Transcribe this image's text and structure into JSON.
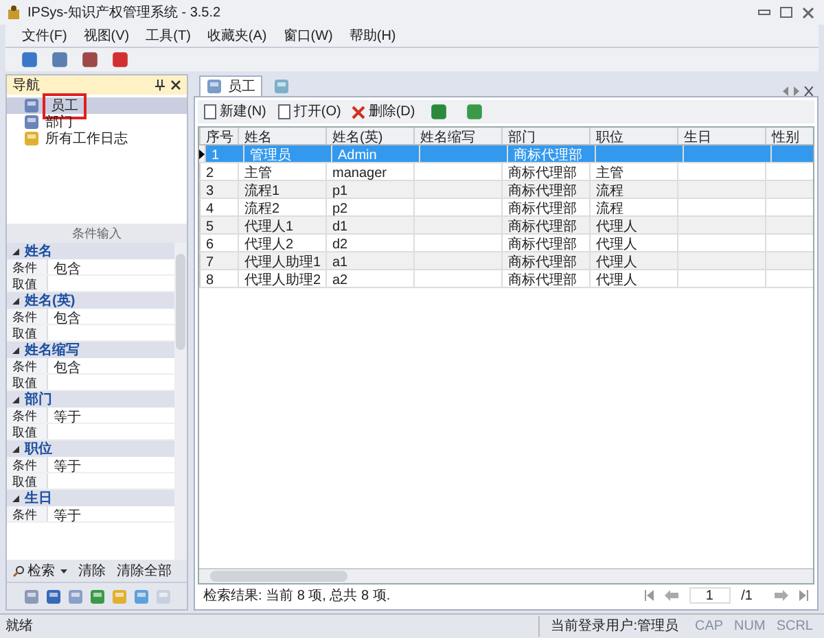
{
  "window": {
    "title": "IPSys-知识产权管理系统 - 3.5.2"
  },
  "menu": [
    "文件(F)",
    "视图(V)",
    "工具(T)",
    "收藏夹(A)",
    "窗口(W)",
    "帮助(H)"
  ],
  "nav": {
    "title": "导航",
    "items": [
      {
        "label": "员工",
        "selected": true
      },
      {
        "label": "部门",
        "selected": false
      },
      {
        "label": "所有工作日志",
        "selected": false
      }
    ]
  },
  "conditions": {
    "title": "条件输入",
    "groups": [
      {
        "name": "姓名",
        "rows": [
          {
            "label": "条件",
            "value": "包含"
          },
          {
            "label": "取值"
          }
        ]
      },
      {
        "name": "姓名(英)",
        "rows": [
          {
            "label": "条件",
            "value": "包含"
          },
          {
            "label": "取值"
          }
        ]
      },
      {
        "name": "姓名缩写",
        "rows": [
          {
            "label": "条件",
            "value": "包含"
          },
          {
            "label": "取值"
          }
        ]
      },
      {
        "name": "部门",
        "rows": [
          {
            "label": "条件",
            "value": "等于"
          },
          {
            "label": "取值"
          }
        ]
      },
      {
        "name": "职位",
        "rows": [
          {
            "label": "条件",
            "value": "等于"
          },
          {
            "label": "取值"
          }
        ]
      },
      {
        "name": "生日",
        "rows": [
          {
            "label": "条件",
            "value": "等于"
          }
        ]
      }
    ],
    "actions": [
      "检索",
      "清除",
      "清除全部"
    ]
  },
  "tabs": [
    {
      "label": "员工",
      "selected": true
    }
  ],
  "toolbar": [
    "新建(N)",
    "打开(O)",
    "删除(D)"
  ],
  "table": {
    "columns": [
      "序号",
      "姓名",
      "姓名(英)",
      "姓名缩写",
      "部门",
      "职位",
      "生日",
      "性别"
    ],
    "rows": [
      {
        "cells": [
          "1",
          "管理员",
          "Admin",
          "",
          "商标代理部",
          "",
          "",
          ""
        ],
        "selected": true
      },
      {
        "cells": [
          "2",
          "主管",
          "manager",
          "",
          "商标代理部",
          "主管",
          "",
          ""
        ],
        "selected": false
      },
      {
        "cells": [
          "3",
          "流程1",
          "p1",
          "",
          "商标代理部",
          "流程",
          "",
          ""
        ],
        "selected": false
      },
      {
        "cells": [
          "4",
          "流程2",
          "p2",
          "",
          "商标代理部",
          "流程",
          "",
          ""
        ],
        "selected": false
      },
      {
        "cells": [
          "5",
          "代理人1",
          "d1",
          "",
          "商标代理部",
          "代理人",
          "",
          ""
        ],
        "selected": false
      },
      {
        "cells": [
          "6",
          "代理人2",
          "d2",
          "",
          "商标代理部",
          "代理人",
          "",
          ""
        ],
        "selected": false
      },
      {
        "cells": [
          "7",
          "代理人助理1",
          "a1",
          "",
          "商标代理部",
          "代理人",
          "",
          ""
        ],
        "selected": false
      },
      {
        "cells": [
          "8",
          "代理人助理2",
          "a2",
          "",
          "商标代理部",
          "代理人",
          "",
          ""
        ],
        "selected": false
      }
    ]
  },
  "result": "检索结果: 当前 8 项, 总共 8 项.",
  "pager": {
    "page": "1",
    "total": "/1"
  },
  "status_bar": {
    "text": "就绪",
    "user": "当前登录用户:管理员",
    "indicators": [
      {
        "label": "CAP",
        "on": false
      },
      {
        "label": "NUM",
        "on": false
      },
      {
        "label": "SCRL",
        "on": false
      }
    ]
  }
}
